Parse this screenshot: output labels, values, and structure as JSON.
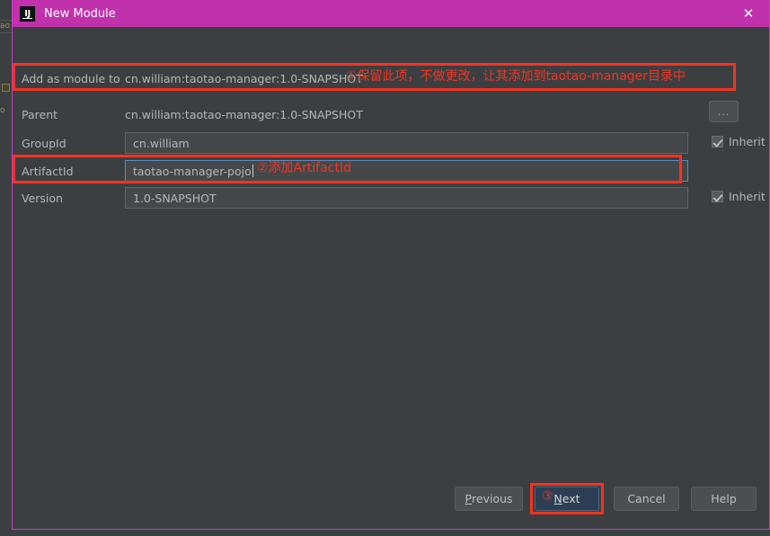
{
  "window": {
    "title": "New Module",
    "logo_text": "IJ",
    "close_icon": "close-icon",
    "close_glyph": "✕"
  },
  "theme": {
    "titlebar_bg": "#c031ab",
    "dialog_bg": "#3c3f41",
    "dialog_border": "#c93dc0",
    "field_bg": "#45484a",
    "text": "#b4b7ba",
    "annotation_red": "#f4331f",
    "focus_blue": "#2c3e54"
  },
  "form": {
    "add_as_module": {
      "label": "Add as module to",
      "value": "cn.william:taotao-manager:1.0-SNAPSHOT"
    },
    "parent": {
      "label": "Parent",
      "value": "cn.william:taotao-manager:1.0-SNAPSHOT"
    },
    "group_id": {
      "label": "GroupId",
      "value": "cn.william",
      "inherit_label": "Inherit",
      "inherit_checked": true
    },
    "artifact_id": {
      "label": "ArtifactId",
      "value": "taotao-manager-pojo",
      "has_caret": true
    },
    "version": {
      "label": "Version",
      "value": "1.0-SNAPSHOT",
      "inherit_label": "Inherit",
      "inherit_checked": true
    },
    "browse_button": "..."
  },
  "buttons": {
    "previous": {
      "prefix": "P",
      "rest": "revious"
    },
    "next": {
      "prefix": "N",
      "rest": "ext"
    },
    "cancel": "Cancel",
    "help": "Help"
  },
  "annotations": [
    {
      "id": "1",
      "marker": "①",
      "text": "①保留此项，不做更改，让其添加到taotao-manager目录中"
    },
    {
      "id": "2",
      "marker": "②",
      "text": "②添加ArtifactId"
    },
    {
      "id": "3",
      "marker": "③",
      "text": "③"
    }
  ],
  "background_strip": {
    "fragments": [
      "ao",
      "o"
    ]
  }
}
